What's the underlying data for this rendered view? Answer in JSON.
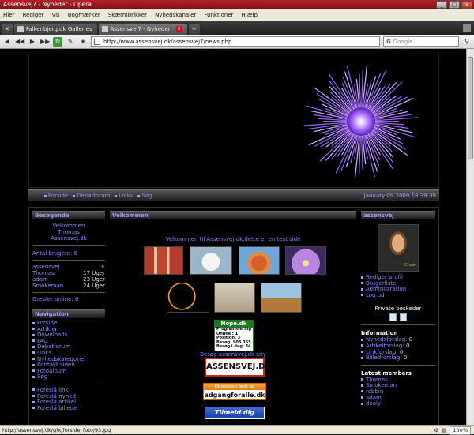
{
  "window": {
    "title": "Assensvej7 - Nyheder - Opera"
  },
  "menu": [
    "Filer",
    "Rediger",
    "Vis",
    "Bogmærker",
    "Skærmbrikker",
    "Nyhedskanaler",
    "Funktioner",
    "Hjælp"
  ],
  "tabs": [
    {
      "label": "Falkenbjerg.dk Galleries"
    },
    {
      "label": "Assensvej7 - Nyheder"
    }
  ],
  "address": {
    "url": "http://www.assensvej.dk/assensvej7/news.php"
  },
  "search": {
    "placeholder": "Google"
  },
  "topnav": {
    "items": [
      "Forside",
      "Debatforum",
      "Links",
      "Søg"
    ],
    "date": "January 09 2009 18:39:39"
  },
  "left": {
    "visitors": {
      "header": "Besøgende",
      "welcome": "Velkommen",
      "name": "Thomas",
      "site": "Assensvej.dk"
    },
    "users_count": "Antal brugere: 6",
    "users": [
      {
        "name": "assensvej",
        "since": ""
      },
      {
        "name": "Thomas",
        "since": "17 Uger"
      },
      {
        "name": "adam",
        "since": "23 Uger"
      },
      {
        "name": "Smokeman",
        "since": "24 Uger"
      }
    ],
    "guests": "Gæster online: 0",
    "navigation": {
      "header": "Navigation",
      "items": [
        "Forside",
        "Artikler",
        "Downloads",
        "FAQ",
        "Debatforum",
        "Links",
        "Nyhedskategorier",
        "Kontakt siden",
        "Fotoalbum",
        "Søg"
      ]
    },
    "suggest": [
      "Foreslå link",
      "Foreslå nyhed",
      "Foreslå artikel",
      "Foreslå billede"
    ]
  },
  "center": {
    "header": "Velkommen",
    "welcome_text": "Velkommen til Assensvej.dk,dette er en test side",
    "nope": {
      "title": "Nope.dk",
      "lines": [
        "Programmering",
        "Online :   1",
        "Position:   3",
        "Besøg:   903.355",
        "Besøg i dag:   34"
      ]
    },
    "city_link": "Besøg assensvej.dk city",
    "assensvej_banner": "ASSENSVEJ.DK",
    "adgang": {
      "top": "Få teksten læst op",
      "bottom": "adgangforalle.dk"
    },
    "tilmeld": "Tilmeld dig"
  },
  "right": {
    "header": "assensvej",
    "avatar_tag": "Crew",
    "profile_links": [
      "Rediger profil",
      "Brugerliste",
      "Administration",
      "Log ud"
    ],
    "private_messages": "Private beskeder",
    "information": {
      "header": "Information",
      "items": [
        {
          "label": "Nyhedsforslag:",
          "value": "0"
        },
        {
          "label": "Artikelforslag:",
          "value": "0"
        },
        {
          "label": "Linkforslag:",
          "value": "0"
        },
        {
          "label": "Billedforslag:",
          "value": "0"
        }
      ]
    },
    "latest": {
      "header": "Latest members",
      "items": [
        "Thomas",
        "Smokeman",
        "robbin",
        "adam",
        "dooly"
      ]
    }
  },
  "status": {
    "url": "http://assensvej.dk/gfx/forside_foto/93.jpg",
    "zoom": "100%"
  }
}
